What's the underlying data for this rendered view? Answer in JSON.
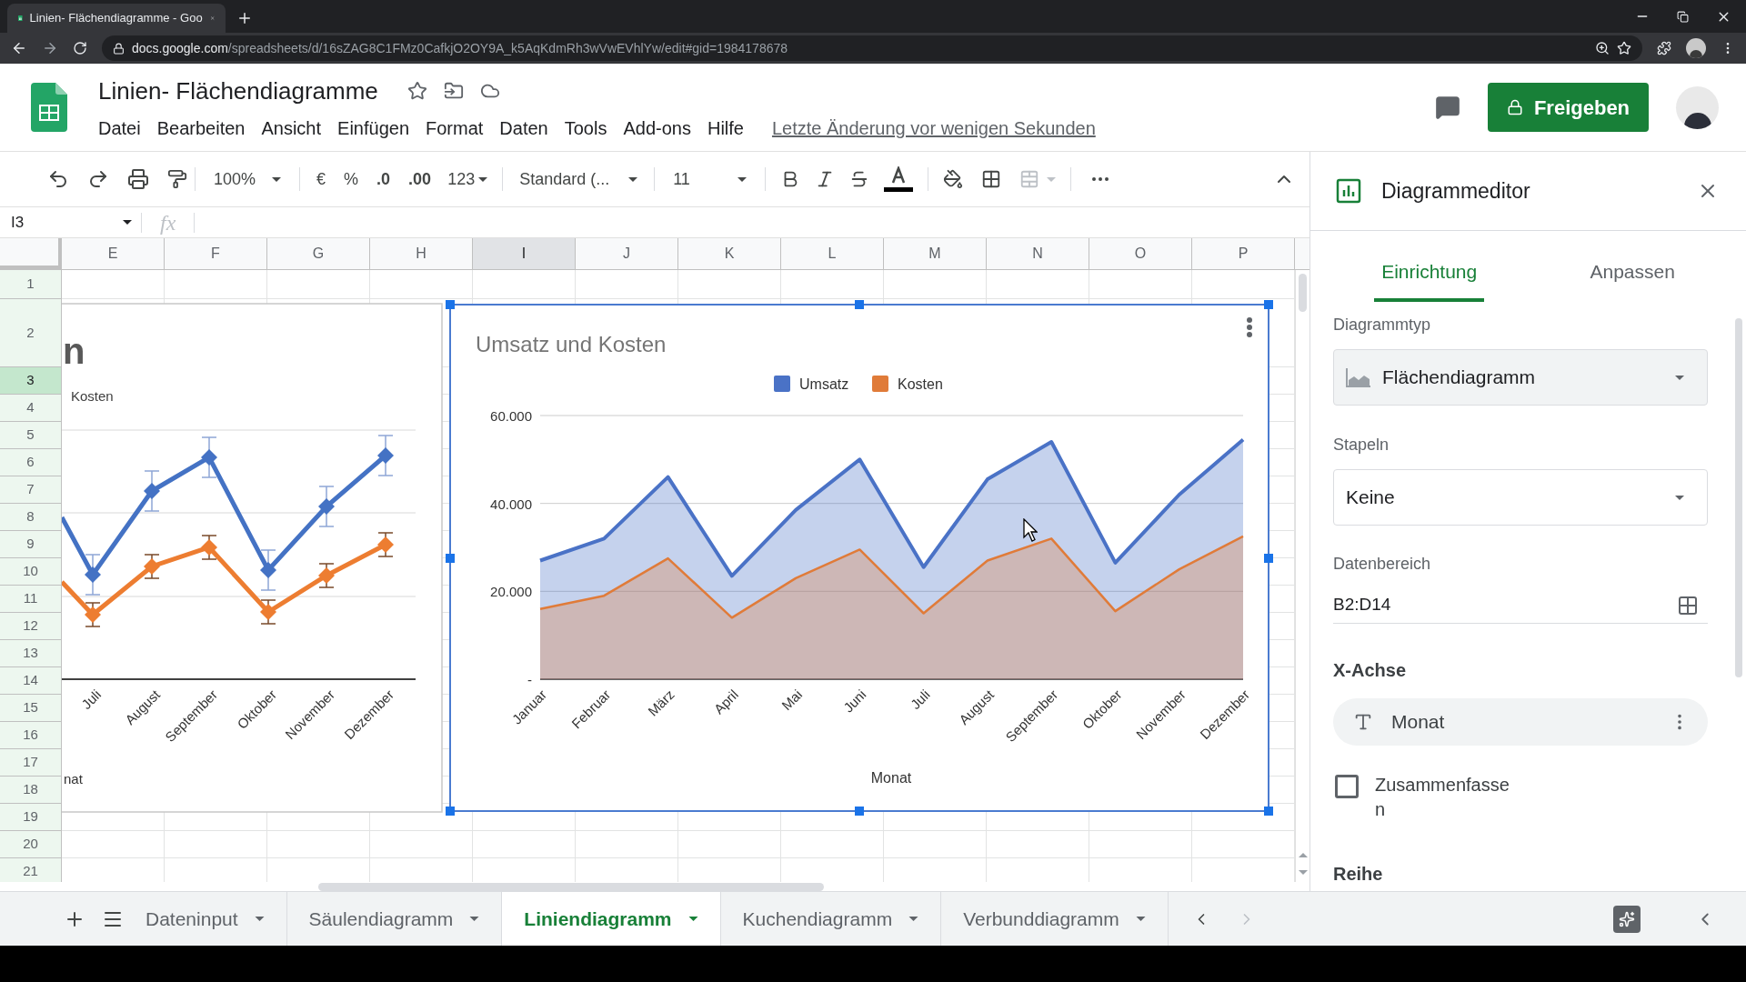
{
  "browser": {
    "tab_title": "Linien- Flächendiagramme - Goo",
    "url_host": "docs.google.com",
    "url_path": "/spreadsheets/d/16sZAG8C1FMz0CafkjO2OY9A_k5AqKdmRh3wVwEVhlYw/edit#gid=1984178678"
  },
  "header": {
    "title": "Linien- Flächendiagramme",
    "menu": [
      "Datei",
      "Bearbeiten",
      "Ansicht",
      "Einfügen",
      "Format",
      "Daten",
      "Tools",
      "Add-ons",
      "Hilfe"
    ],
    "last_edit": "Letzte Änderung vor wenigen Sekunden",
    "share_button": "Freigeben"
  },
  "toolbar": {
    "zoom": "100%",
    "currency": "€",
    "percent": "%",
    "decrease_decimals": ".0",
    "increase_decimals": ".00",
    "number_format": "123",
    "font": "Standard (...",
    "font_size": "11"
  },
  "formula_bar": {
    "cell_ref": "I3",
    "fx": "fx"
  },
  "columns": [
    {
      "label": "E",
      "selected": false
    },
    {
      "label": "F",
      "selected": false
    },
    {
      "label": "G",
      "selected": false
    },
    {
      "label": "H",
      "selected": false
    },
    {
      "label": "I",
      "selected": true
    },
    {
      "label": "J",
      "selected": false
    },
    {
      "label": "K",
      "selected": false
    },
    {
      "label": "L",
      "selected": false
    },
    {
      "label": "M",
      "selected": false
    },
    {
      "label": "N",
      "selected": false
    },
    {
      "label": "O",
      "selected": false
    },
    {
      "label": "P",
      "selected": false
    }
  ],
  "rows": [
    {
      "label": "1",
      "selected": false
    },
    {
      "label": "2",
      "selected": false
    },
    {
      "label": "3",
      "selected": true
    },
    {
      "label": "4",
      "selected": false
    },
    {
      "label": "5",
      "selected": false
    },
    {
      "label": "6",
      "selected": false
    },
    {
      "label": "7",
      "selected": false
    },
    {
      "label": "8",
      "selected": false
    },
    {
      "label": "9",
      "selected": false
    },
    {
      "label": "10",
      "selected": false
    },
    {
      "label": "11",
      "selected": false
    },
    {
      "label": "12",
      "selected": false
    },
    {
      "label": "13",
      "selected": false
    },
    {
      "label": "14",
      "selected": false
    },
    {
      "label": "15",
      "selected": false
    },
    {
      "label": "16",
      "selected": false
    },
    {
      "label": "17",
      "selected": false
    },
    {
      "label": "18",
      "selected": false
    },
    {
      "label": "19",
      "selected": false
    },
    {
      "label": "20",
      "selected": false
    },
    {
      "label": "21",
      "selected": false
    }
  ],
  "left_chart": {
    "title_fragment": "n",
    "legend": "Kosten",
    "x_labels": [
      "Juli",
      "August",
      "September",
      "Oktober",
      "November",
      "Dezember"
    ],
    "axis_title": "nat"
  },
  "chart": {
    "chart_data": {
      "type": "area",
      "title": "Umsatz und Kosten",
      "xlabel": "Monat",
      "categories": [
        "Januar",
        "Februar",
        "März",
        "April",
        "Mai",
        "Juni",
        "Juli",
        "August",
        "September",
        "Oktober",
        "November",
        "Dezember"
      ],
      "series": [
        {
          "name": "Umsatz",
          "color": "#4a72c6",
          "values": [
            27000,
            32000,
            46000,
            23500,
            38500,
            50000,
            25500,
            45500,
            54000,
            26500,
            42000,
            54500
          ]
        },
        {
          "name": "Kosten",
          "color": "#e07b39",
          "values": [
            16000,
            19000,
            27500,
            14000,
            23000,
            29500,
            15000,
            27000,
            32000,
            15500,
            25000,
            32500
          ]
        }
      ],
      "legend": "top",
      "ylim": [
        0,
        60000
      ],
      "yticks": [
        {
          "value": 0,
          "label": "-"
        },
        {
          "value": 20000,
          "label": "20.000"
        },
        {
          "value": 40000,
          "label": "40.000"
        },
        {
          "value": 60000,
          "label": "60.000"
        }
      ],
      "stacked": false
    }
  },
  "chart_editor": {
    "title": "Diagrammeditor",
    "tabs": [
      {
        "label": "Einrichtung",
        "selected": true
      },
      {
        "label": "Anpassen",
        "selected": false
      }
    ],
    "chart_type": {
      "label": "Diagrammtyp",
      "value": "Flächendiagramm"
    },
    "stacking": {
      "label": "Stapeln",
      "value": "Keine"
    },
    "data_range": {
      "label": "Datenbereich",
      "value": "B2:D14"
    },
    "x_axis": {
      "label": "X-Achse",
      "value": "Monat"
    },
    "aggregate": {
      "label": "Zusammenfassen",
      "checked": false
    },
    "series_heading": "Reihe"
  },
  "sheet_tabs": [
    {
      "label": "Dateninput",
      "selected": false
    },
    {
      "label": "Säulendiagramm",
      "selected": false
    },
    {
      "label": "Liniendiagramm",
      "selected": true
    },
    {
      "label": "Kuchendiagramm",
      "selected": false
    },
    {
      "label": "Verbunddiagramm",
      "selected": false
    }
  ]
}
